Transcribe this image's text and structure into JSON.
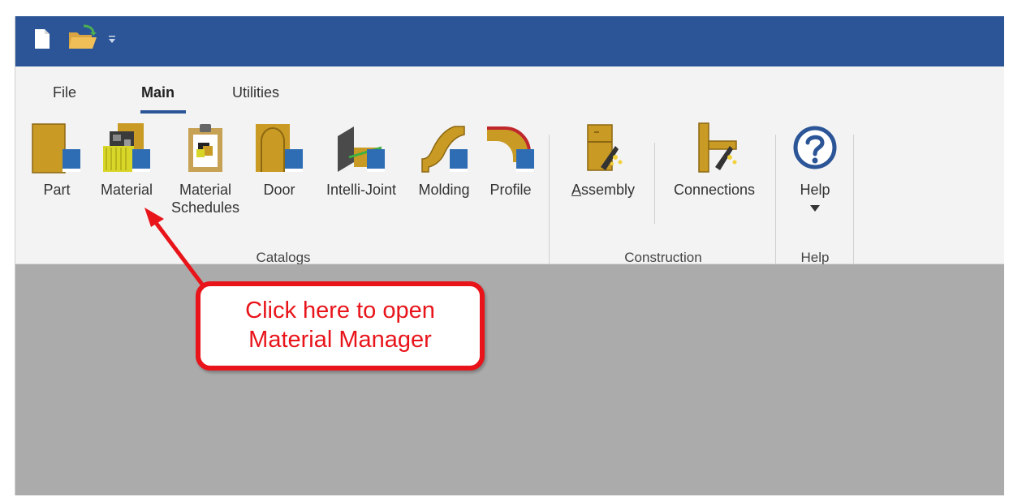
{
  "qat": {
    "new_icon": "new-document-icon",
    "open_icon": "open-folder-icon",
    "dropdown_icon": "customize-qat-icon"
  },
  "tabs": [
    {
      "label": "File",
      "active": false
    },
    {
      "label": "Main",
      "active": true
    },
    {
      "label": "Utilities",
      "active": false
    }
  ],
  "groups": {
    "catalogs": {
      "label": "Catalogs",
      "buttons": [
        {
          "label": "Part",
          "icon": "part-icon"
        },
        {
          "label": "Material",
          "icon": "material-icon"
        },
        {
          "label_line1": "Material",
          "label_line2": "Schedules",
          "icon": "material-schedules-icon"
        },
        {
          "label": "Door",
          "icon": "door-icon"
        },
        {
          "label": "Intelli-Joint",
          "icon": "intelli-joint-icon"
        },
        {
          "label": "Molding",
          "icon": "molding-icon"
        },
        {
          "label": "Profile",
          "icon": "profile-icon"
        }
      ]
    },
    "construction": {
      "label": "Construction",
      "buttons": [
        {
          "label_underlined": "A",
          "label_rest": "ssembly",
          "icon": "assembly-icon"
        },
        {
          "label": "Connections",
          "icon": "connections-icon"
        }
      ]
    },
    "help": {
      "label": "Help",
      "buttons": [
        {
          "label": "Help",
          "icon": "help-icon"
        }
      ]
    }
  },
  "annotation": {
    "line1": "Click here to open",
    "line2": "Material Manager",
    "color": "#e8141a"
  },
  "colors": {
    "titlebar": "#2b5597",
    "ribbon": "#f3f3f3",
    "workspace": "#ababab"
  }
}
